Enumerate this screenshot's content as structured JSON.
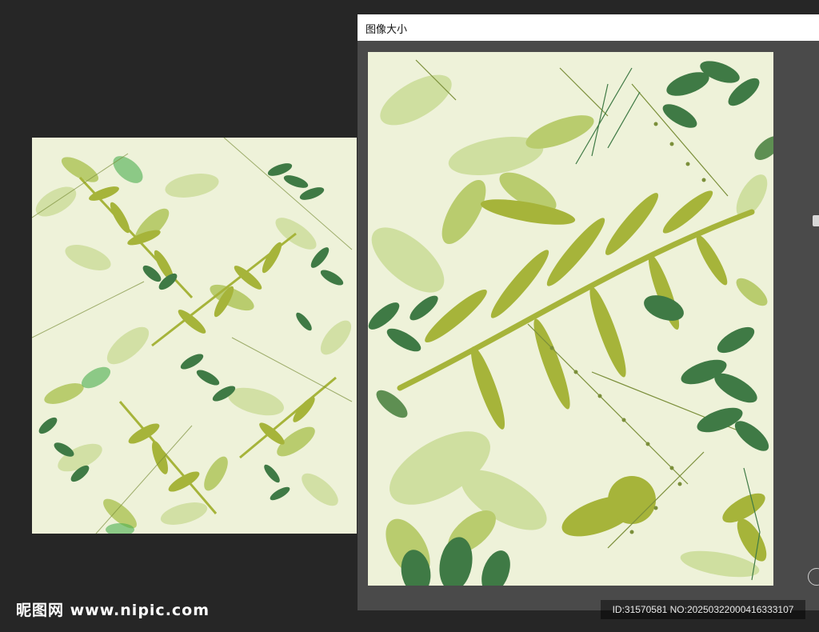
{
  "dialog": {
    "title": "图像大小"
  },
  "watermark": {
    "logo_text": "昵图网 www.nipic.com",
    "id_text": "ID:31570581 NO:20250322000416333107"
  },
  "artwork": {
    "background_color": "#eef2d9",
    "palette": [
      "#a6b43a",
      "#b9cc6e",
      "#cfdfa0",
      "#3f7a45",
      "#5e8f52",
      "#c8d98a"
    ]
  }
}
